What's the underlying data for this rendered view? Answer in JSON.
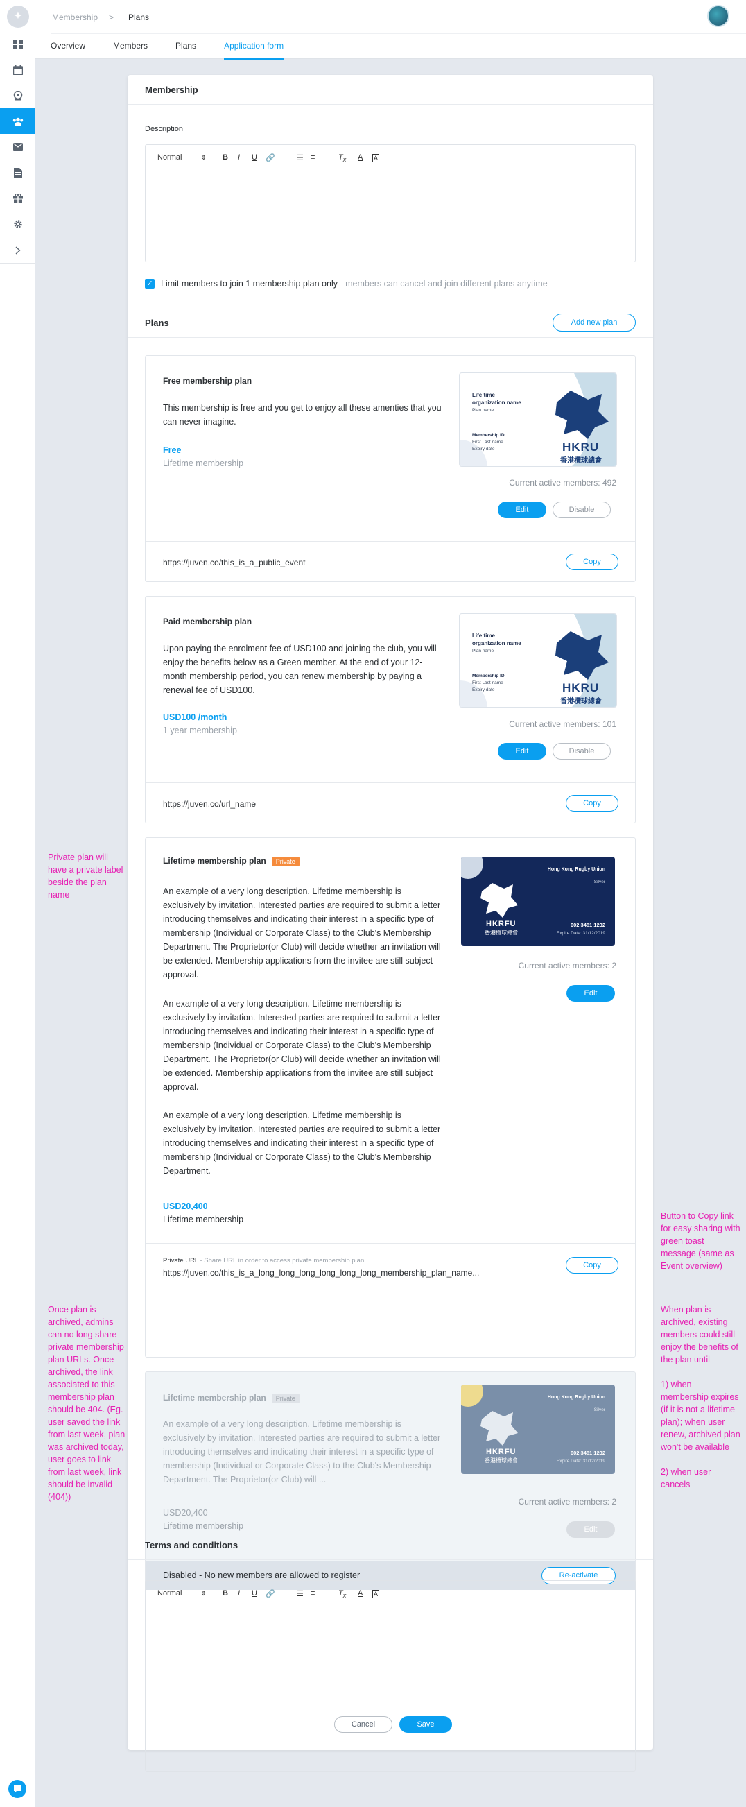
{
  "breadcrumb": {
    "parent": "Membership",
    "separator": ">",
    "current": "Plans"
  },
  "tabs": [
    {
      "label": "Overview"
    },
    {
      "label": "Members"
    },
    {
      "label": "Plans"
    },
    {
      "label": "Application form",
      "active": true
    }
  ],
  "membership": {
    "heading": "Membership",
    "description_label": "Description",
    "limit_checkbox_label": "Limit members to join 1 membership plan only",
    "limit_checkbox_hint": " - members can cancel and join different plans anytime",
    "limit_checked": true
  },
  "editor_toolbar": {
    "format": "Normal"
  },
  "plans_section": {
    "heading": "Plans",
    "add_button": "Add new plan"
  },
  "plans": [
    {
      "title": "Free membership plan",
      "description": "This membership is free and you get to enjoy all these amenties that you can never imagine.",
      "price": "Free",
      "period": "Lifetime membership",
      "active_members": "Current active members: 492",
      "edit": "Edit",
      "disable": "Disable",
      "url": "https://juven.co/this_is_a_public_event",
      "copy": "Copy",
      "card": {
        "line1": "Life time",
        "line2": "organization name",
        "plan_name": "Plan name",
        "id": "Membership ID",
        "name": "First Last name",
        "expiry": "Expiry date",
        "brand": "HKRU",
        "brand_cn": "香港欖球總會"
      }
    },
    {
      "title": "Paid membership plan",
      "description": "Upon paying the enrolment fee of USD100 and joining the club, you will enjoy the benefits below as a Green member. At the end of your 12-month membership period, you can renew membership by paying a renewal fee of USD100.",
      "price": "USD100 /month",
      "period": "1 year membership",
      "active_members": "Current active members: 101",
      "edit": "Edit",
      "disable": "Disable",
      "url": "https://juven.co/url_name",
      "copy": "Copy",
      "card": {
        "line1": "Life time",
        "line2": "organization name",
        "plan_name": "Plan name",
        "id": "Membership ID",
        "name": "First Last name",
        "expiry": "Expiry date",
        "brand": "HKRU",
        "brand_cn": "香港欖球總會"
      }
    },
    {
      "title": "Lifetime membership plan",
      "badge": "Private",
      "description_1": "An example of a very long description. Lifetime membership is exclusively by invitation. Interested parties are required to submit a letter introducing themselves and indicating their interest in a specific type of membership (Individual or Corporate Class) to the Club's Membership Department. The Proprietor(or Club) will decide whether an invitation will be extended. Membership applications from the invitee are still subject approval.",
      "description_2": "An example of a very long description. Lifetime membership is exclusively by invitation. Interested parties are required to submit a letter introducing themselves and indicating their interest in a specific type of membership (Individual or Corporate Class) to the Club's Membership Department. The Proprietor(or Club) will decide whether an invitation will be extended. Membership applications from the invitee are still subject approval.",
      "description_3": "An example of a very long description. Lifetime membership is exclusively by invitation. Interested parties are required to submit a letter introducing themselves and indicating their interest in a specific type of membership (Individual or Corporate Class) to the Club's Membership Department.",
      "price": "USD20,400",
      "period": "Lifetime membership",
      "active_members": "Current active members: 2",
      "edit": "Edit",
      "private_url_label": "Private URL",
      "private_url_hint": " - Share URL in order to access private membership plan",
      "url": "https://juven.co/this_is_a_long_long_long_long_long_long_membership_plan_name...",
      "copy": "Copy",
      "card": {
        "org": "Hong Kong Rugby Union",
        "tier": "Silver",
        "brand": "HKRFU",
        "brand_cn": "香港欖球總會",
        "number": "002 3481 1232",
        "expire": "Expire Date: 31/12/2019"
      }
    },
    {
      "title": "Lifetime membership plan",
      "badge": "Private",
      "description": "An example of a very long description. Lifetime membership is exclusively by invitation. Interested parties are required to submit a letter introducing themselves and indicating their interest in a specific type of membership (Individual or Corporate Class) to the Club's Membership Department. The Proprietor(or Club) will ...",
      "price": "USD20,400",
      "period": "Lifetime membership",
      "active_members": "Current active members: 2",
      "edit": "Edit",
      "disabled_text": "Disabled - No new members are allowed to register",
      "reactivate": "Re-activate",
      "card": {
        "org": "Hong Kong Rugby Union",
        "tier": "Silver",
        "brand": "HKRFU",
        "brand_cn": "香港欖球總會",
        "number": "002 3481 1232",
        "expire": "Expire Date: 31/12/2019"
      }
    }
  ],
  "terms": {
    "heading": "Terms and conditions"
  },
  "footer": {
    "cancel": "Cancel",
    "save": "Save"
  },
  "notes": {
    "private": "Private plan will have a private label beside the plan name",
    "copy": "Button to Copy link for easy sharing with green toast message (same as Event overview)",
    "archived_left": "Once plan is archived, admins can no long share private membership plan URLs. Once archived, the link associated to this membership plan should be 404. (Eg. user saved the link from last week, plan was archived today, user goes to link from last week, link should be invalid (404))",
    "archived_right": "When plan is archived, existing members could still enjoy the benefits of the plan until",
    "archived_right_1": "1) when membership expires (if it is not a lifetime plan); when user renew, archived plan won't be available",
    "archived_right_2": "2) when user cancels"
  },
  "colors": {
    "accent": "#0a9ff0",
    "note": "#e621b3",
    "private_badge": "#f58b3c",
    "card_navy": "#13285a"
  }
}
